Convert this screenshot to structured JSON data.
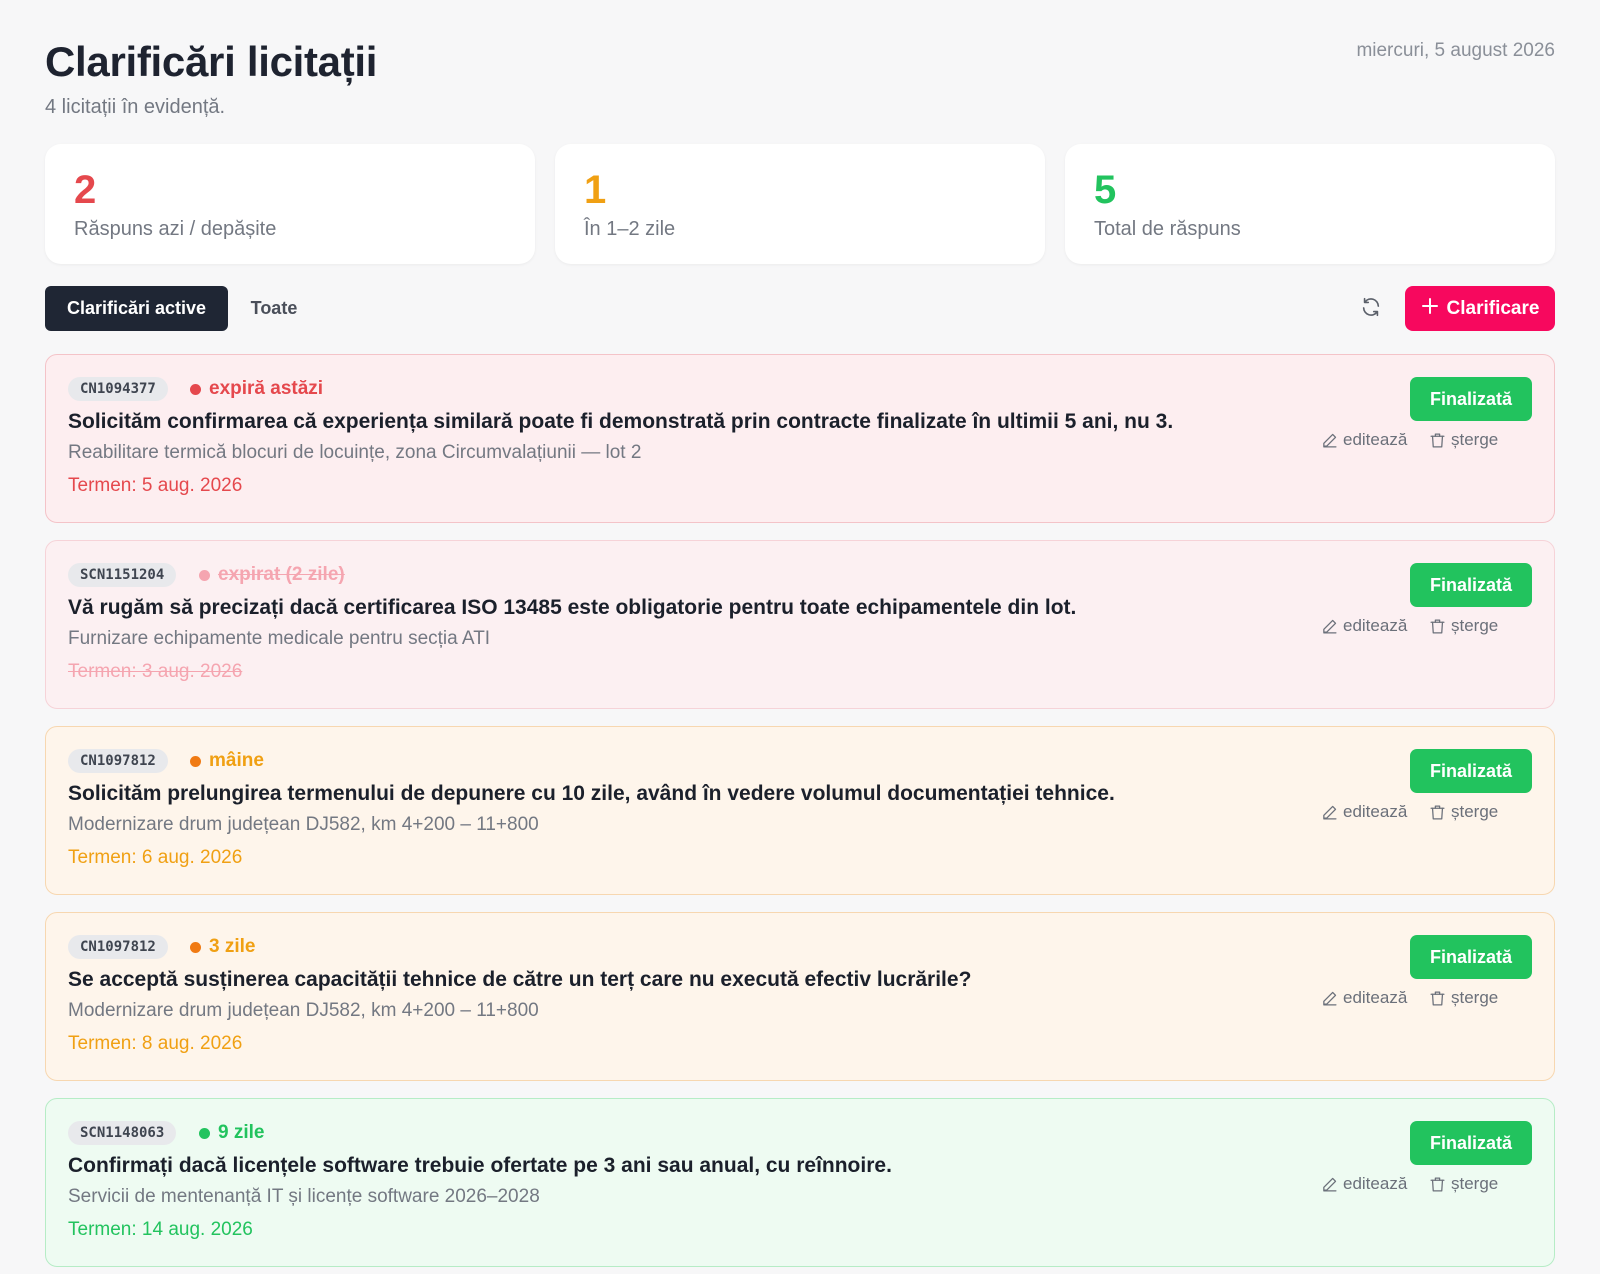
{
  "header": {
    "title": "Clarificări licitații",
    "subtitle": "4 licitații în evidență.",
    "date": "miercuri, 5 august 2026"
  },
  "stats": [
    {
      "value": "2",
      "label": "Răspuns azi / depășite",
      "color": "#e5484d"
    },
    {
      "value": "1",
      "label": "În 1–2 zile",
      "color": "#f0a013"
    },
    {
      "value": "5",
      "label": "Total de răspuns",
      "color": "#22c35e"
    }
  ],
  "toolbar": {
    "tab_active": "Clarificări active",
    "tab_all": "Toate",
    "add_label": "Clarificare",
    "refresh_icon": "refresh-icon",
    "add_icon": "plus-icon"
  },
  "actions": {
    "done_label": "Finalizată",
    "edit_label": "editează",
    "delete_label": "șterge"
  },
  "clarifications": [
    {
      "code": "CN1094377",
      "status": "expiră astăzi",
      "question": "Solicităm confirmarea că experiența similară poate fi demonstrată prin contracte finalizate în ultimii 5 ani, nu 3.",
      "project": "Reabilitare termică blocuri de locuințe, zona Circumvalațiunii — lot 2",
      "deadline": "Termen: 5 aug. 2026",
      "status_color": "#e5484d"
    },
    {
      "code": "SCN1151204",
      "status": "expirat (2 zile)",
      "question": "Vă rugăm să precizați dacă certificarea ISO 13485 este obligatorie pentru toate echipamentele din lot.",
      "project": "Furnizare echipamente medicale pentru secția ATI",
      "deadline": "Termen: 3 aug. 2026",
      "status_color": "#f5a5b0"
    },
    {
      "code": "CN1097812",
      "status": "mâine",
      "question": "Solicităm prelungirea termenului de depunere cu 10 zile, având în vedere volumul documentației tehnice.",
      "project": "Modernizare drum județean DJ582, km 4+200 – 11+800",
      "deadline": "Termen: 6 aug. 2026",
      "status_color": "#f0a013"
    },
    {
      "code": "CN1097812",
      "status": "3 zile",
      "question": "Se acceptă susținerea capacității tehnice de către un terț care nu execută efectiv lucrările?",
      "project": "Modernizare drum județean DJ582, km 4+200 – 11+800",
      "deadline": "Termen: 8 aug. 2026",
      "status_color": "#f0a013"
    },
    {
      "code": "SCN1148063",
      "status": "9 zile",
      "question": "Confirmați dacă licențele software trebuie ofertate pe 3 ani sau anual, cu reînnoire.",
      "project": "Servicii de mentenanță IT și licențe software 2026–2028",
      "deadline": "Termen: 14 aug. 2026",
      "status_color": "#22c35e"
    }
  ]
}
